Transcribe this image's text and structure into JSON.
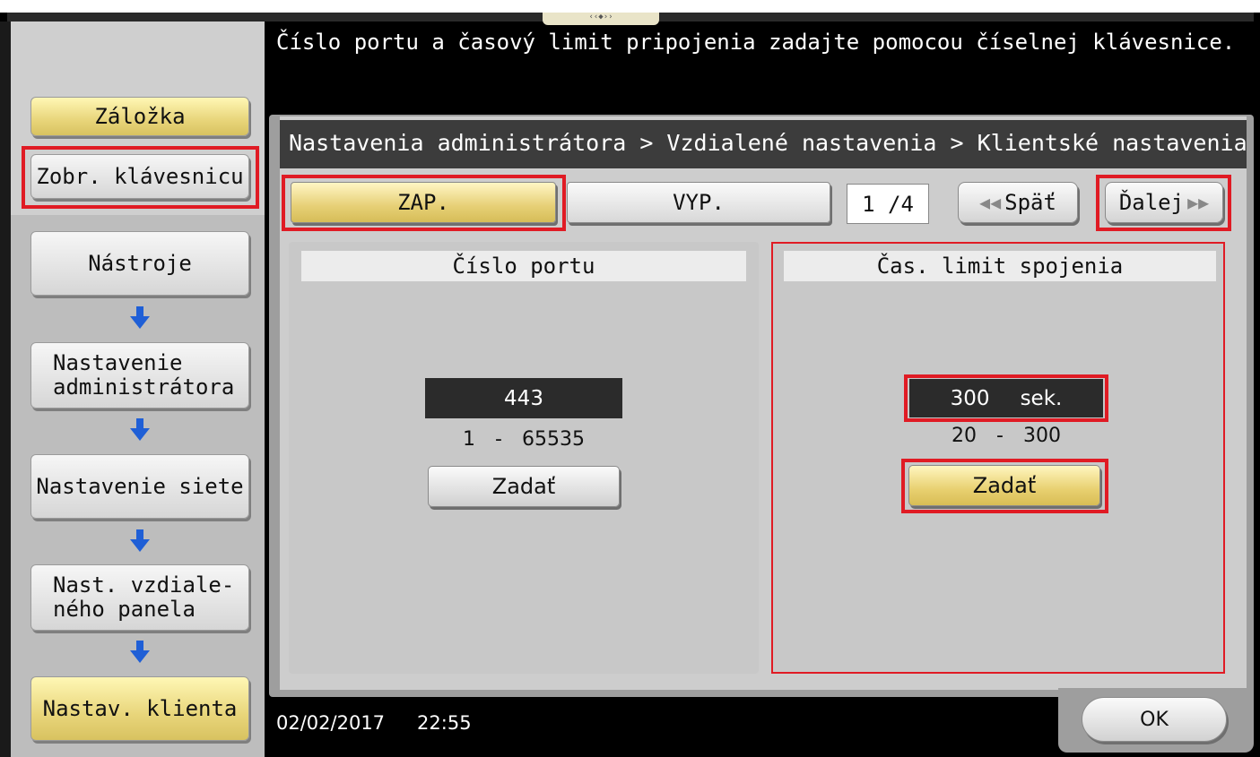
{
  "header": {
    "message": "Číslo portu a časový limit pripojenia zadajte pomocou číselnej klávesnice."
  },
  "sidebar": {
    "bookmark_label": "Záložka",
    "show_keypad_label": "Zobr. klávesnicu",
    "nav_items": [
      {
        "label": "Nástroje"
      },
      {
        "label": "Nastavenie\nadministrátora"
      },
      {
        "label": "Nastavenie siete"
      },
      {
        "label": "Nast. vzdiale-\nného panela"
      },
      {
        "label": "Nastav. klienta"
      }
    ]
  },
  "breadcrumb": "Nastavenia administrátora > Vzdialené nastavenia > Klientské nastavenia",
  "toggle": {
    "on_label": "ZAP.",
    "off_label": "VYP.",
    "selected": "ZAP."
  },
  "pagination": {
    "indicator": "1 /4",
    "back_label": "Späť",
    "next_label": "Ďalej"
  },
  "port": {
    "title": "Číslo portu",
    "value": "443",
    "range_min": "1",
    "range_sep": "-",
    "range_max": "65535",
    "enter_label": "Zadať"
  },
  "timeout": {
    "title": "Čas. limit spojenia",
    "value": "300",
    "unit": "sek.",
    "range_min": "20",
    "range_sep": "-",
    "range_max": "300",
    "enter_label": "Zadať"
  },
  "footer": {
    "date": "02/02/2017",
    "time": "22:55",
    "ok_label": "OK"
  },
  "colors": {
    "highlight_red": "#e01b24",
    "selected_yellow": "#e8d57a",
    "arrow_blue": "#1f5fd6"
  },
  "icons": {
    "down_arrow": "down-arrow-icon",
    "prev": "double-chevron-left-icon",
    "next": "double-chevron-right-icon"
  }
}
